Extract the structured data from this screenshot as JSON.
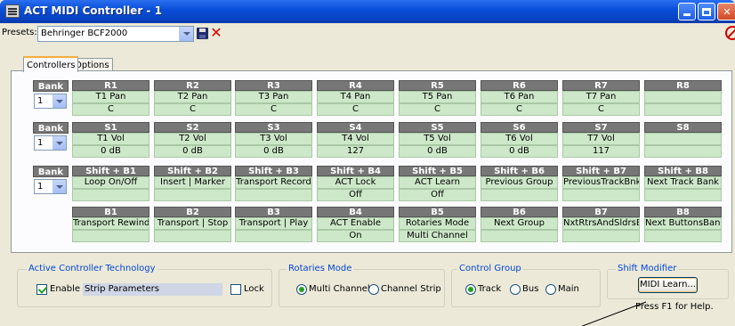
{
  "window": {
    "title": "ACT MIDI Controller - 1"
  },
  "presets": {
    "label": "Presets:",
    "value": "Behringer BCF2000"
  },
  "tabs": [
    {
      "label": "Controllers"
    },
    {
      "label": "Options"
    }
  ],
  "bank_label": "Bank",
  "rows": [
    {
      "bank": "1",
      "cells": [
        {
          "h": "R1",
          "a": "T1 Pan",
          "b": "C"
        },
        {
          "h": "R2",
          "a": "T2 Pan",
          "b": "C"
        },
        {
          "h": "R3",
          "a": "T3 Pan",
          "b": "C"
        },
        {
          "h": "R4",
          "a": "T4 Pan",
          "b": "C"
        },
        {
          "h": "R5",
          "a": "T5 Pan",
          "b": "C"
        },
        {
          "h": "R6",
          "a": "T6 Pan",
          "b": "C"
        },
        {
          "h": "R7",
          "a": "T7 Pan",
          "b": "C"
        },
        {
          "h": "R8",
          "a": "",
          "b": ""
        }
      ]
    },
    {
      "bank": "1",
      "cells": [
        {
          "h": "S1",
          "a": "T1 Vol",
          "b": "0 dB"
        },
        {
          "h": "S2",
          "a": "T2 Vol",
          "b": "0 dB"
        },
        {
          "h": "S3",
          "a": "T3 Vol",
          "b": "0 dB"
        },
        {
          "h": "S4",
          "a": "T4 Vol",
          "b": "127"
        },
        {
          "h": "S5",
          "a": "T5 Vol",
          "b": "0 dB"
        },
        {
          "h": "S6",
          "a": "T6 Vol",
          "b": "0 dB"
        },
        {
          "h": "S7",
          "a": "T7 Vol",
          "b": "117"
        },
        {
          "h": "S8",
          "a": "",
          "b": ""
        }
      ]
    },
    {
      "bank": "1",
      "cells": [
        {
          "h": "Shift + B1",
          "a": "Loop On/Off",
          "b": ""
        },
        {
          "h": "Shift + B2",
          "a": "Insert | Marker",
          "b": ""
        },
        {
          "h": "Shift + B3",
          "a": "Transport Record",
          "b": ""
        },
        {
          "h": "Shift + B4",
          "a": "ACT Lock",
          "b": "Off"
        },
        {
          "h": "Shift + B5",
          "a": "ACT Learn",
          "b": "Off"
        },
        {
          "h": "Shift + B6",
          "a": "Previous Group",
          "b": ""
        },
        {
          "h": "Shift + B7",
          "a": "PreviousTrackBnk",
          "b": ""
        },
        {
          "h": "Shift + B8",
          "a": "Next Track Bank",
          "b": ""
        }
      ]
    },
    {
      "bank": null,
      "cells": [
        {
          "h": "B1",
          "a": "Transport Rewind",
          "b": ""
        },
        {
          "h": "B2",
          "a": "Transport | Stop",
          "b": ""
        },
        {
          "h": "B3",
          "a": "Transport | Play",
          "b": ""
        },
        {
          "h": "B4",
          "a": "ACT Enable",
          "b": "On"
        },
        {
          "h": "B5",
          "a": "Rotaries Mode",
          "b": "Multi Channel"
        },
        {
          "h": "B6",
          "a": "Next Group",
          "b": ""
        },
        {
          "h": "B7",
          "a": "NxtRtrsAndSldrsB",
          "b": ""
        },
        {
          "h": "B8",
          "a": "Next ButtonsBank",
          "b": ""
        }
      ]
    }
  ],
  "act": {
    "title": "Active Controller Technology",
    "enable_label": "Enable",
    "enable_checked": true,
    "strip_value": "Strip Parameters",
    "lock_label": "Lock"
  },
  "rotaries": {
    "title": "Rotaries Mode",
    "options": [
      "Multi Channel",
      "Channel Strip"
    ],
    "selected": "Multi Channel"
  },
  "control_group": {
    "title": "Control Group",
    "options": [
      "Track",
      "Bus",
      "Main"
    ],
    "selected": "Track"
  },
  "shift": {
    "title": "Shift Modifier",
    "button": "MIDI Learn..."
  },
  "status": {
    "help": "Press F1 for Help."
  }
}
